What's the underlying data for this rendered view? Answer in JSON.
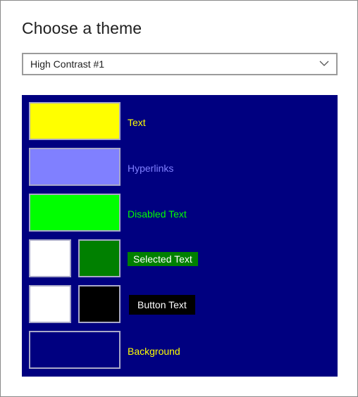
{
  "heading": "Choose a theme",
  "theme_select": {
    "value": "High Contrast #1",
    "icon": "chevron-down-icon"
  },
  "preview": {
    "background_color": "#000080",
    "rows": {
      "text": {
        "label": "Text",
        "swatch_color": "#ffff00",
        "label_color": "#ffff00"
      },
      "hyperlinks": {
        "label": "Hyperlinks",
        "swatch_color": "#8080ff",
        "label_color": "#8080ff"
      },
      "disabled_text": {
        "label": "Disabled Text",
        "swatch_color": "#00ff00",
        "label_color": "#00ff00"
      },
      "selected_text": {
        "label": "Selected Text",
        "fg_swatch_color": "#ffffff",
        "bg_swatch_color": "#008000"
      },
      "button_text": {
        "label": "Button Text",
        "fg_swatch_color": "#ffffff",
        "bg_swatch_color": "#000000"
      },
      "background": {
        "label": "Background",
        "swatch_color": "#000080",
        "label_color": "#ffff00"
      }
    }
  }
}
